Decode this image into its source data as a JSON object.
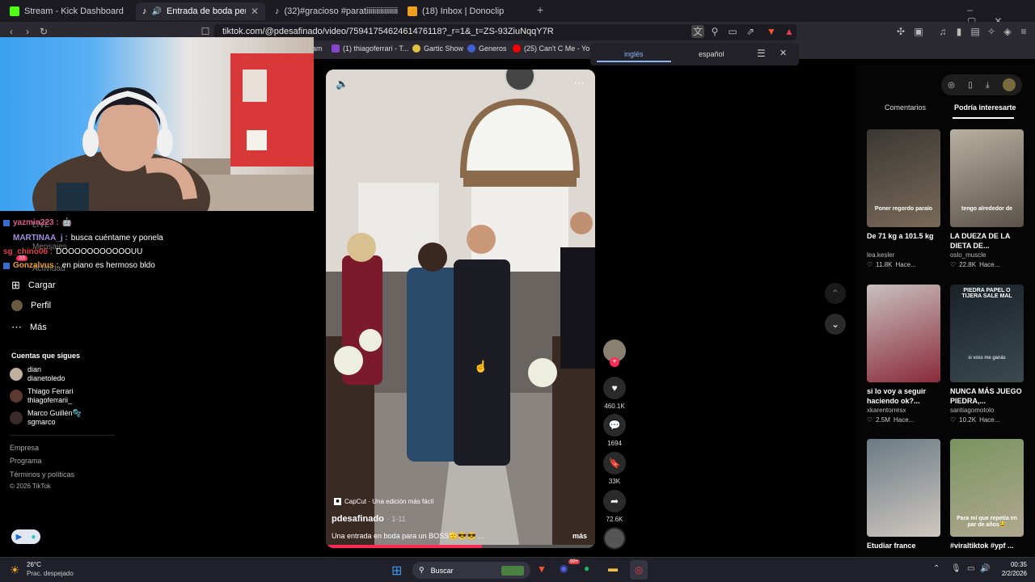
{
  "tabs": [
    {
      "label": "Stream - Kick Dashboard",
      "color": "#53fc18"
    },
    {
      "label": "Entrada de boda personaliza",
      "color": "#000000",
      "active": true
    },
    {
      "label": "(32)#gracioso #paratiiiiiiiiiiiiiiiii",
      "color": "#000000"
    },
    {
      "label": "(18) Inbox | Donoclip",
      "color": "#f0a020"
    }
  ],
  "url": "tiktok.com/@pdesafinado/video/7594175462461476118?_r=1&_t=ZS-93ZiuNqqY7R",
  "bookmarks": [
    "(1) thiagoferrari - T...",
    "Gartic Show",
    "Generos",
    "(25) Can't C Me - Yo..."
  ],
  "bookmark_partial": "am",
  "translate": {
    "from": "inglés",
    "to": "español"
  },
  "chat": [
    {
      "user": "yazmin223 :",
      "msg": "",
      "color": "#e05a8c"
    },
    {
      "user": "MARTINAA_j :",
      "msg": "busca cuéntame y ponela",
      "color": "#a58de0"
    },
    {
      "user": "sg_chino06 :",
      "msg": "DOOOOOOOOOOOUU",
      "color": "#e04040"
    },
    {
      "user": "Gonzalvus :",
      "msg": "en piano es hermoso bldo",
      "color": "#f0a020"
    }
  ],
  "ghost_menu": {
    "live": "LIVE",
    "mensajes": "Mensajes",
    "actividad": "Actividad",
    "badge": "33"
  },
  "menu": {
    "cargar": "Cargar",
    "perfil": "Perfil",
    "mas": "Más"
  },
  "following": {
    "title": "Cuentas que sigues",
    "accounts": [
      {
        "name": "dian",
        "handle": "dianetoledo"
      },
      {
        "name": "Thiago Ferrari",
        "handle": "thiagoferrarii_"
      },
      {
        "name": "Marco Guillén🫧",
        "handle": "sgmarco"
      }
    ]
  },
  "footer": {
    "empresa": "Empresa",
    "programa": "Programa",
    "terminos": "Términos y políticas",
    "copy": "© 2026 TikTok"
  },
  "video": {
    "capcut": "CapCut · Una edición más fácil",
    "author": "pdesafinado",
    "date": "· 1-11",
    "caption": "Una entrada en boda para un BOSS🫡😎😎 ...",
    "more": "más"
  },
  "actions": {
    "likes": "460.1K",
    "comments": "1694",
    "saves": "33K",
    "shares": "72.6K"
  },
  "right_tabs": {
    "comments": "Comentarios",
    "suggested": "Podría interesarte"
  },
  "cards": [
    {
      "title": "De 71 kg a 101.5 kg",
      "user": "lea.kesler",
      "likes": "11.8K",
      "time": "Hace...",
      "overlay": "Poner regordo paraío",
      "c1": "#3a3834",
      "c2": "#7a6a58"
    },
    {
      "title": "LA DUEZA DE LA DIETA DE...",
      "user": "oslo_muscle",
      "likes": "22.8K",
      "time": "Hace...",
      "overlay": "tengo alrededor de",
      "c1": "#b8b0a0",
      "c2": "#5a5248"
    },
    {
      "title": "si lo voy a seguir haciendo ok?...",
      "user": "xkarentorresx",
      "likes": "2.5M",
      "time": "Hace...",
      "overlay": "",
      "c1": "#c8c0c0",
      "c2": "#8a2a3a"
    },
    {
      "title": "NUNCA MÁS JUEGO PIEDRA,...",
      "user": "santiagomotolo",
      "likes": "10.2K",
      "time": "Hace...",
      "overlay": "PIEDRA PAPEL O TIJERA SALE MAL",
      "overlay2": "si voss me ganás",
      "c1": "#1a2228",
      "c2": "#3a4a50"
    },
    {
      "title": "Etudiar france",
      "user": "",
      "likes": "",
      "time": "",
      "overlay": "",
      "c1": "#6a7a84",
      "c2": "#d0c8c0"
    },
    {
      "title": "#viraltiktok #ypf ...",
      "user": "",
      "likes": "",
      "time": "",
      "overlay": "Para mí que repetía en par de años😂",
      "c1": "#7a9460",
      "c2": "#b0a890"
    }
  ],
  "taskbar": {
    "temp": "26°C",
    "weather": "Prac. despejado",
    "search": "Buscar",
    "time": "00:35",
    "date": "2/2/2026",
    "badge": "99+"
  }
}
